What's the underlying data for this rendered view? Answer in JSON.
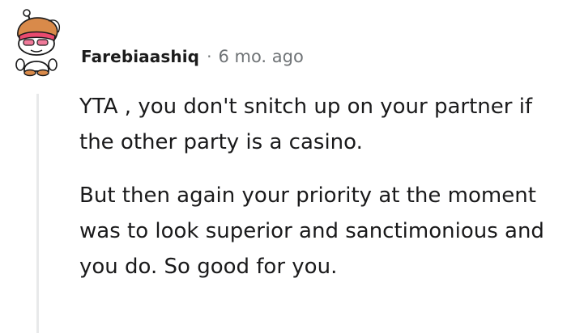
{
  "comment": {
    "author": "Farebiaashiq",
    "separator": "·",
    "timestamp": "6 mo. ago",
    "paragraphs": [
      "YTA , you don't snitch up on your partner if the other party is a casino.",
      "But then again your priority at the moment was to look superior and sanctimonious and you do. So good for you."
    ],
    "avatar_icon": "snoo-avatar-icon"
  },
  "colors": {
    "author": "#1c1c1c",
    "meta": "#787c7e",
    "thread_line": "#e8e9ea",
    "avatar_headband": "#e94a6f",
    "avatar_hair": "#d4874a"
  }
}
